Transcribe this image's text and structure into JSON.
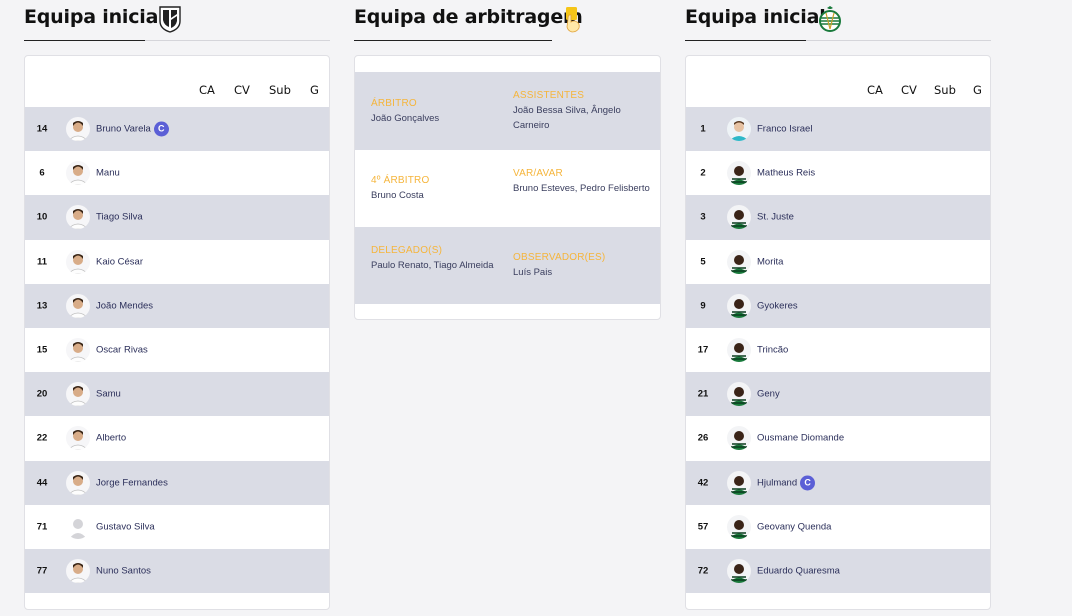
{
  "home": {
    "title": "Equipa inicial",
    "crest_icon": "vitoria-guimaraes-crest-icon",
    "columns": [
      "CA",
      "CV",
      "Sub",
      "G"
    ],
    "players": [
      {
        "num": "14",
        "name": "Bruno Varela",
        "captain": true,
        "captain_badge": "C"
      },
      {
        "num": "6",
        "name": "Manu"
      },
      {
        "num": "10",
        "name": "Tiago Silva"
      },
      {
        "num": "11",
        "name": "Kaio César"
      },
      {
        "num": "13",
        "name": "João Mendes"
      },
      {
        "num": "15",
        "name": "Oscar Rivas"
      },
      {
        "num": "20",
        "name": "Samu"
      },
      {
        "num": "22",
        "name": "Alberto"
      },
      {
        "num": "44",
        "name": "Jorge Fernandes"
      },
      {
        "num": "71",
        "name": "Gustavo Silva",
        "placeholder": true
      },
      {
        "num": "77",
        "name": "Nuno Santos"
      }
    ]
  },
  "referees": {
    "title": "Equipa de arbitragem",
    "icon": "whistle-hand-icon",
    "blocks": [
      {
        "left": {
          "role": "ÁRBITRO",
          "names": "João Gonçalves"
        },
        "right": {
          "role": "ASSISTENTES",
          "names": "João Bessa Silva, Ângelo Carneiro"
        }
      },
      {
        "left": {
          "role": "4º ÁRBITRO",
          "names": "Bruno Costa"
        },
        "right": {
          "role": "VAR/AVAR",
          "names": "Bruno Esteves, Pedro Felisberto"
        }
      },
      {
        "left": {
          "role": "DELEGADO(S)",
          "names": "Paulo Renato, Tiago Almeida"
        },
        "right": {
          "role": "OBSERVADOR(ES)",
          "names": "Luís Pais"
        }
      }
    ]
  },
  "away": {
    "title": "Equipa inicial",
    "crest_icon": "sporting-cp-crest-icon",
    "columns": [
      "CA",
      "CV",
      "Sub",
      "G"
    ],
    "players": [
      {
        "num": "1",
        "name": "Franco Israel",
        "keeper": true
      },
      {
        "num": "2",
        "name": "Matheus Reis"
      },
      {
        "num": "3",
        "name": "St. Juste"
      },
      {
        "num": "5",
        "name": "Morita"
      },
      {
        "num": "9",
        "name": "Gyokeres"
      },
      {
        "num": "17",
        "name": "Trincão"
      },
      {
        "num": "21",
        "name": "Geny"
      },
      {
        "num": "26",
        "name": "Ousmane Diomande"
      },
      {
        "num": "42",
        "name": "Hjulmand",
        "captain": true,
        "captain_badge": "C"
      },
      {
        "num": "57",
        "name": "Geovany Quenda"
      },
      {
        "num": "72",
        "name": "Eduardo Quaresma"
      }
    ]
  },
  "colors": {
    "accent_orange": "#f5b53c",
    "captain_badge": "#5b5fd6",
    "row_alt": "#dadce5",
    "sporting_green": "#1a7a3c"
  }
}
